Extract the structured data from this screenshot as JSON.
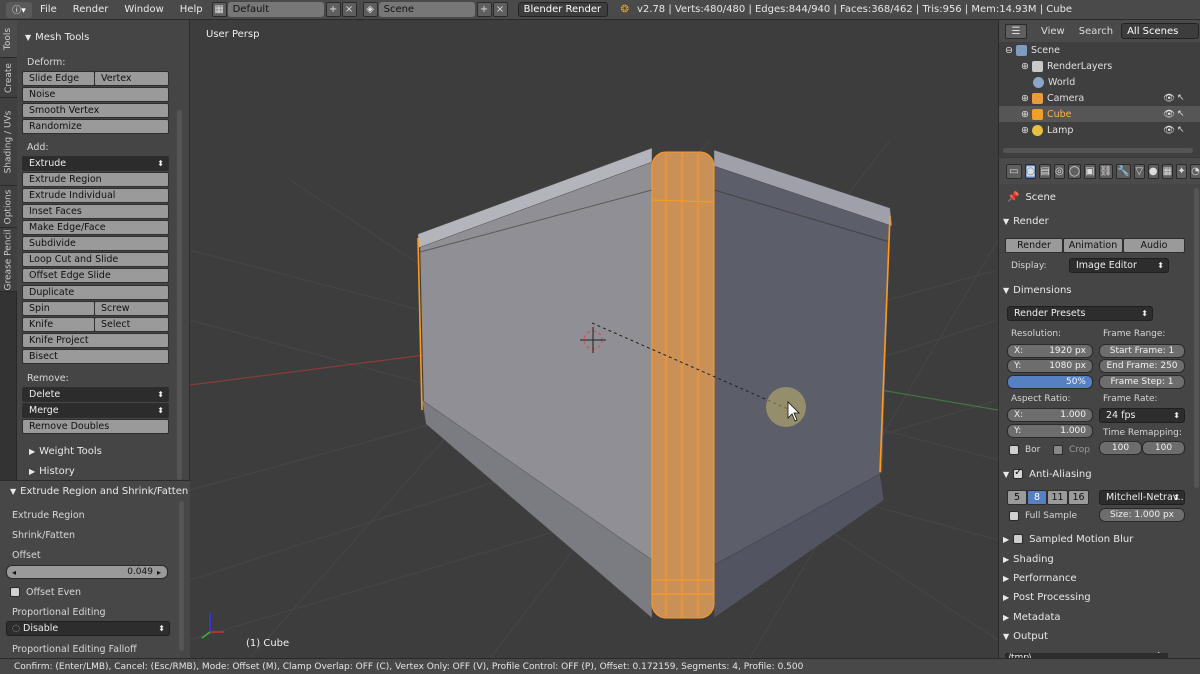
{
  "topbar": {
    "menu": [
      "File",
      "Render",
      "Window",
      "Help"
    ],
    "layout": "Default",
    "scene": "Scene",
    "engine": "Blender Render",
    "stats": "v2.78 | Verts:480/480 | Edges:844/940 | Faces:368/462 | Tris:956 | Mem:14.93M | Cube"
  },
  "tabs": [
    "Tools",
    "Create",
    "Shading / UVs",
    "Options",
    "Grease Pencil"
  ],
  "shelf": {
    "mesh_tools": "Mesh Tools",
    "deform_label": "Deform:",
    "slide_edge": "Slide Edge",
    "vertex": "Vertex",
    "noise": "Noise",
    "smooth_vertex": "Smooth Vertex",
    "randomize": "Randomize",
    "add_label": "Add:",
    "extrude": "Extrude",
    "extrude_region": "Extrude Region",
    "extrude_individual": "Extrude Individual",
    "inset_faces": "Inset Faces",
    "make_edge_face": "Make Edge/Face",
    "subdivide": "Subdivide",
    "loop_cut": "Loop Cut and Slide",
    "offset_edge_slide": "Offset Edge Slide",
    "duplicate": "Duplicate",
    "spin": "Spin",
    "screw": "Screw",
    "knife": "Knife",
    "select": "Select",
    "knife_project": "Knife Project",
    "bisect": "Bisect",
    "remove_label": "Remove:",
    "delete": "Delete",
    "merge": "Merge",
    "remove_doubles": "Remove Doubles",
    "weight_tools": "Weight Tools",
    "history": "History"
  },
  "operator": {
    "title": "Extrude Region and Shrink/Fatten",
    "extrude_region": "Extrude Region",
    "shrink_fatten": "Shrink/Fatten",
    "offset_label": "Offset",
    "offset_value": "0.049",
    "offset_even": "Offset Even",
    "prop_editing": "Proportional Editing",
    "prop_value": "Disable",
    "prop_falloff": "Proportional Editing Falloff"
  },
  "viewport": {
    "view_name": "User Persp",
    "object_name": "(1) Cube"
  },
  "outliner": {
    "view": "View",
    "search": "Search",
    "all_scenes": "All Scenes",
    "items": [
      "Scene",
      "RenderLayers",
      "World",
      "Camera",
      "Cube",
      "Lamp"
    ]
  },
  "props": {
    "scene": "Scene",
    "render": "Render",
    "render_btn": "Render",
    "animation_btn": "Animation",
    "audio_btn": "Audio",
    "display_label": "Display:",
    "display_value": "Image Editor",
    "dimensions": "Dimensions",
    "render_presets": "Render Presets",
    "resolution": "Resolution:",
    "res_x_label": "X:",
    "res_x": "1920 px",
    "res_y_label": "Y:",
    "res_y": "1080 px",
    "res_pct": "50%",
    "frame_range": "Frame Range:",
    "start_frame": "Start Frame: 1",
    "end_frame": "End Frame: 250",
    "frame_step": "Frame Step: 1",
    "aspect": "Aspect Ratio:",
    "asp_x_label": "X:",
    "asp_x": "1.000",
    "asp_y_label": "Y:",
    "asp_y": "1.000",
    "frame_rate": "Frame Rate:",
    "fps": "24 fps",
    "bor": "Bor",
    "crop": "Crop",
    "time_remap": "Time Remapping:",
    "remap_old": "100",
    "remap_new": "100",
    "anti_aliasing": "Anti-Aliasing",
    "aa_samples": [
      "5",
      "8",
      "11",
      "16"
    ],
    "aa_filter": "Mitchell-Netrav...",
    "full_sample": "Full Sample",
    "size": "Size: 1.000 px",
    "sampled_motion_blur": "Sampled Motion Blur",
    "shading": "Shading",
    "performance": "Performance",
    "post_processing": "Post Processing",
    "metadata": "Metadata",
    "output": "Output",
    "output_path": "/tmp\\"
  },
  "statusbar": "Confirm: (Enter/LMB), Cancel: (Esc/RMB), Mode: Offset (M), Clamp Overlap: OFF (C), Vertex Only: OFF (V), Profile Control: OFF (P), Offset: 0.172159, Segments: 4, Profile: 0.500"
}
